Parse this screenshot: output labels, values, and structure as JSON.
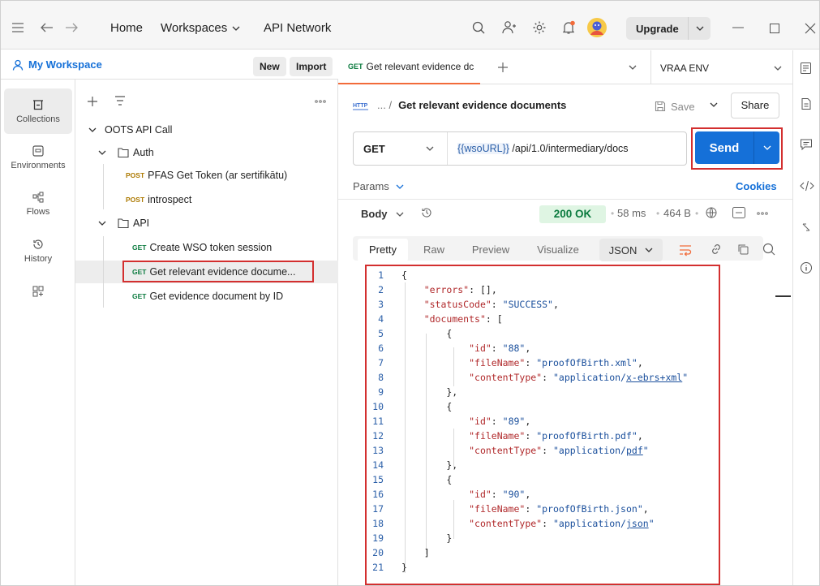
{
  "topbar": {
    "home": "Home",
    "workspaces": "Workspaces",
    "api_network": "API Network",
    "upgrade": "Upgrade"
  },
  "rail": {
    "collections": "Collections",
    "environments": "Environments",
    "flows": "Flows",
    "history": "History"
  },
  "workspace": {
    "name": "My Workspace",
    "new": "New",
    "import": "Import"
  },
  "tree": {
    "collection": "OOTS API Call",
    "folder_auth": "Auth",
    "folder_api": "API",
    "items": [
      {
        "method": "POST",
        "name": "PFAS Get Token (ar sertifikātu)"
      },
      {
        "method": "POST",
        "name": "introspect"
      },
      {
        "method": "GET",
        "name": "Create WSO token session"
      },
      {
        "method": "GET",
        "name": "Get relevant evidence docume..."
      },
      {
        "method": "GET",
        "name": "Get evidence document by ID"
      }
    ]
  },
  "tab": {
    "method": "GET",
    "title": "Get relevant evidence dc",
    "env": "VRAA ENV"
  },
  "request": {
    "breadcrumb_sep": "... /",
    "name": "Get relevant evidence documents",
    "save": "Save",
    "share": "Share",
    "method": "GET",
    "url_var": "{{wsoURL}}",
    "url_path": " /api/1.0/intermediary/docs",
    "send": "Send",
    "params": "Params",
    "cookies": "Cookies"
  },
  "response": {
    "body": "Body",
    "status": "200 OK",
    "time": "58 ms",
    "size": "464 B",
    "tabs": [
      "Pretty",
      "Raw",
      "Preview",
      "Visualize"
    ],
    "format": "JSON"
  },
  "code": {
    "line_numbers": [
      "1",
      "2",
      "3",
      "4",
      "5",
      "6",
      "7",
      "8",
      "9",
      "10",
      "11",
      "12",
      "13",
      "14",
      "15",
      "16",
      "17",
      "18",
      "19",
      "20",
      "21"
    ],
    "errors_key": "\"errors\"",
    "errors_val": "[]",
    "status_key": "\"statusCode\"",
    "status_val": "\"SUCCESS\"",
    "documents_key": "\"documents\"",
    "id_key": "\"id\"",
    "filename_key": "\"fileName\"",
    "ctype_key": "\"contentType\"",
    "docs": [
      {
        "id": "\"88\"",
        "file": "\"proofOfBirth.xml\"",
        "ct_prefix": "\"application/",
        "ct_sub": "x-ebrs+xml",
        "ct_end": "\""
      },
      {
        "id": "\"89\"",
        "file": "\"proofOfBirth.pdf\"",
        "ct_prefix": "\"application/",
        "ct_sub": "pdf",
        "ct_end": "\""
      },
      {
        "id": "\"90\"",
        "file": "\"proofOfBirth.json\"",
        "ct_prefix": "\"application/",
        "ct_sub": "json",
        "ct_end": "\""
      }
    ]
  },
  "colors": {
    "send": "#1570d8",
    "highlight": "#d32f2f",
    "status_bg": "#dff5e3",
    "status_text": "#0a7a3e"
  },
  "icons": [
    "menu-icon",
    "back-icon",
    "forward-icon",
    "search-icon",
    "invite-icon",
    "settings-icon",
    "bell-icon",
    "avatar",
    "minimize-icon",
    "maximize-icon",
    "close-icon",
    "collections-icon",
    "environments-icon",
    "flows-icon",
    "history-icon",
    "add-tool-icon",
    "plus-icon",
    "filter-icon",
    "more-icon",
    "chevron-down-icon",
    "folder-icon",
    "http-icon",
    "save-icon",
    "history-small-icon",
    "globe-icon",
    "example-icon",
    "wrap-icon",
    "link-icon",
    "copy-icon",
    "docs-icon",
    "comments-icon",
    "code-icon",
    "info-icon"
  ]
}
